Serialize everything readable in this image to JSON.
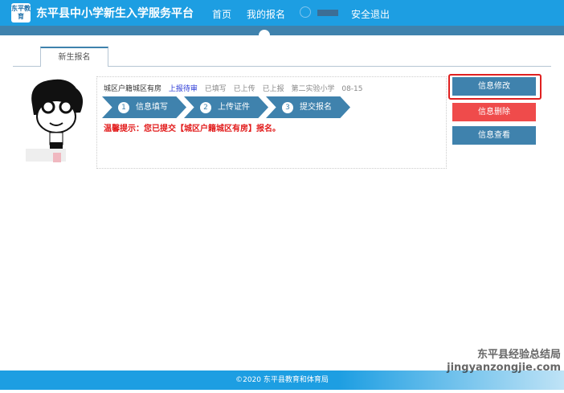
{
  "header": {
    "logo_text": "东平教育",
    "title": "东平县中小学新生入学服务平台",
    "nav": [
      "首页",
      "我的报名"
    ],
    "logout": "安全退出"
  },
  "tab": "新生报名",
  "record": {
    "category": "城区户籍城区有房",
    "status": "上报待审",
    "filled": "已填写",
    "uploaded": "已上传",
    "reported": "已上报",
    "school": "第二实验小学",
    "date": "08-15"
  },
  "steps": [
    {
      "num": "1",
      "label": "信息填写"
    },
    {
      "num": "2",
      "label": "上传证件"
    },
    {
      "num": "3",
      "label": "提交报名"
    }
  ],
  "tip": "温馨提示：您已提交【城区户籍城区有房】报名。",
  "buttons": {
    "edit": "信息修改",
    "delete": "信息删除",
    "view": "信息查看"
  },
  "colors": {
    "primary": "#3f82ad",
    "danger": "#ef4b4b",
    "header": "#1d9ee2"
  },
  "footer": "©2020 东平县教育和体育局",
  "watermark": "东平县经验总结局 jingyanzongjie.com"
}
